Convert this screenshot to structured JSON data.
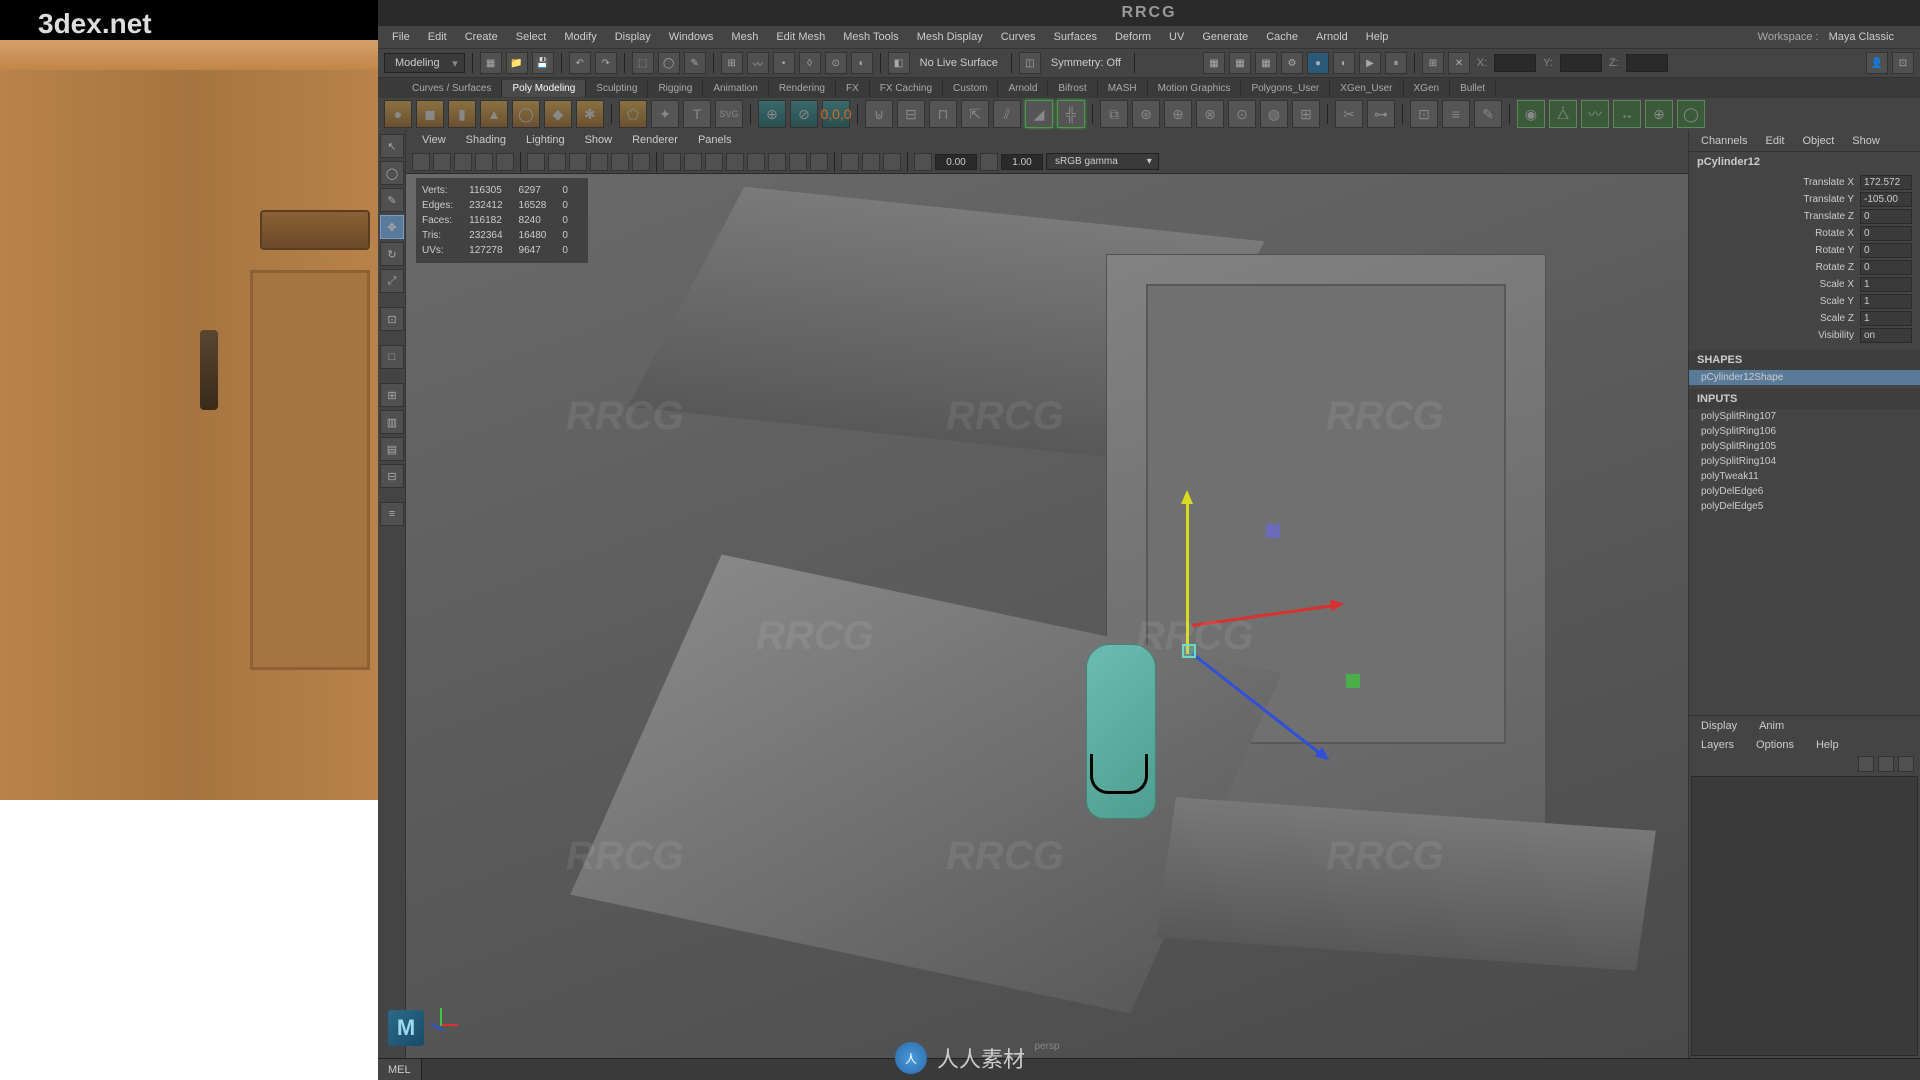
{
  "site_label": "3dex.net",
  "title_watermark": "RRCG",
  "menu": [
    "File",
    "Edit",
    "Create",
    "Select",
    "Modify",
    "Display",
    "Windows",
    "Mesh",
    "Edit Mesh",
    "Mesh Tools",
    "Mesh Display",
    "Curves",
    "Surfaces",
    "Deform",
    "UV",
    "Generate",
    "Cache",
    "Arnold",
    "Help"
  ],
  "workspace_label": "Workspace :",
  "workspace_value": "Maya Classic",
  "mode_dropdown": "Modeling",
  "no_live_surface": "No Live Surface",
  "symmetry": "Symmetry: Off",
  "axis_x_label": "X:",
  "axis_y_label": "Y:",
  "axis_z_label": "Z:",
  "shelf_tabs": [
    "Curves / Surfaces",
    "Poly Modeling",
    "Sculpting",
    "Rigging",
    "Animation",
    "Rendering",
    "FX",
    "FX Caching",
    "Custom",
    "Arnold",
    "Bifrost",
    "MASH",
    "Motion Graphics",
    "Polygons_User",
    "XGen_User",
    "XGen",
    "Bullet"
  ],
  "shelf_active_index": 1,
  "panel_menu": [
    "View",
    "Shading",
    "Lighting",
    "Show",
    "Renderer",
    "Panels"
  ],
  "exposure_value": "0.00",
  "gamma_value": "1.00",
  "gamma_mode": "sRGB gamma",
  "hud": {
    "headers": [
      "",
      "",
      ""
    ],
    "rows": [
      {
        "label": "Verts:",
        "a": "116305",
        "b": "6297",
        "c": "0"
      },
      {
        "label": "Edges:",
        "a": "232412",
        "b": "16528",
        "c": "0"
      },
      {
        "label": "Faces:",
        "a": "116182",
        "b": "8240",
        "c": "0"
      },
      {
        "label": "Tris:",
        "a": "232364",
        "b": "16480",
        "c": "0"
      },
      {
        "label": "UVs:",
        "a": "127278",
        "b": "9647",
        "c": "0"
      }
    ]
  },
  "camera_label": "persp",
  "channel_tabs": [
    "Channels",
    "Edit",
    "Object",
    "Show"
  ],
  "object_name": "pCylinder12",
  "transforms": [
    {
      "label": "Translate X",
      "value": "172.572"
    },
    {
      "label": "Translate Y",
      "value": "-105.00"
    },
    {
      "label": "Translate Z",
      "value": "0"
    },
    {
      "label": "Rotate X",
      "value": "0"
    },
    {
      "label": "Rotate Y",
      "value": "0"
    },
    {
      "label": "Rotate Z",
      "value": "0"
    },
    {
      "label": "Scale X",
      "value": "1"
    },
    {
      "label": "Scale Y",
      "value": "1"
    },
    {
      "label": "Scale Z",
      "value": "1"
    },
    {
      "label": "Visibility",
      "value": "on"
    }
  ],
  "shapes_header": "SHAPES",
  "shape_name": "pCylinder12Shape",
  "inputs_header": "INPUTS",
  "inputs": [
    "polySplitRing107",
    "polySplitRing106",
    "polySplitRing105",
    "polySplitRing104",
    "polyTweak11",
    "polyDelEdge6",
    "polyDelEdge5"
  ],
  "layer_tabs": [
    "Display",
    "Anim"
  ],
  "layer_menu": [
    "Layers",
    "Options",
    "Help"
  ],
  "cmd_label": "MEL",
  "footer_text": "人人素材",
  "maya_logo": "M"
}
